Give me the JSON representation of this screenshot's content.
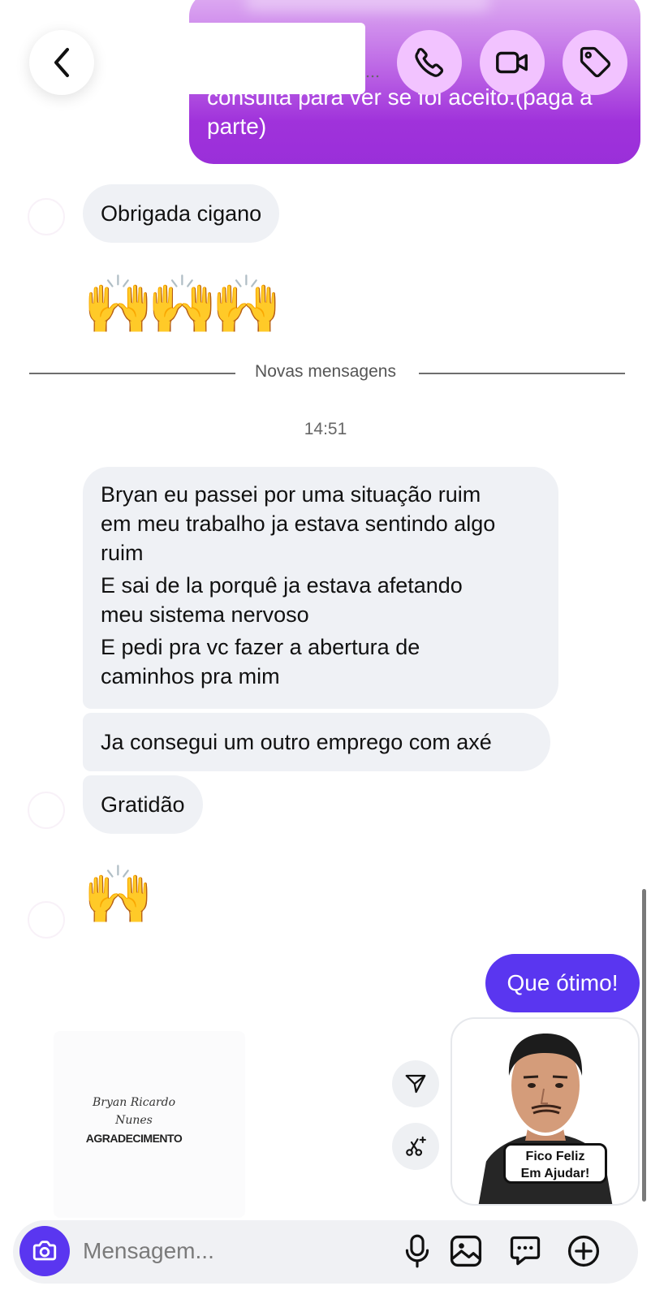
{
  "header": {
    "top_message_text": "consulta para ver se foi aceito.(paga a parte)",
    "icons": {
      "back": "chevron-left-icon",
      "call": "phone-icon",
      "video": "video-camera-icon",
      "tag": "tag-icon"
    },
    "accent_color": "#f2c3ff"
  },
  "messages": {
    "in_1": "Obrigada cigano",
    "emoji_1": "🙌🙌🙌",
    "divider": "Novas mensagens",
    "time": "14:51",
    "in_2_lines": [
      "Bryan eu passei por uma situação ruim",
      "em meu trabalho ja estava sentindo algo",
      "ruim",
      "E sai de la porquê ja estava afetando",
      "meu sistema nervoso",
      "E pedi pra vc fazer a abertura de",
      "caminhos pra mim"
    ],
    "in_3": "Ja consegui um outro emprego com axé",
    "in_4": "Gratidão",
    "emoji_2": "🙌",
    "out_1": "Que ótimo!"
  },
  "attachments": {
    "document": {
      "name_line1": "Bryan Ricardo",
      "name_line2": "Nunes",
      "title": "AGRADECIMENTO"
    },
    "sticker": {
      "caption_line1": "Fico Feliz",
      "caption_line2": "Em Ajudar!"
    }
  },
  "composer": {
    "placeholder": "Mensagem...",
    "icons": [
      "camera-icon",
      "microphone-icon",
      "image-icon",
      "sticker-chat-icon",
      "plus-circle-icon"
    ]
  },
  "colors": {
    "outgoing": "#5a36f0",
    "incoming": "#eff1f5",
    "top_bubble": "#a534dc"
  }
}
